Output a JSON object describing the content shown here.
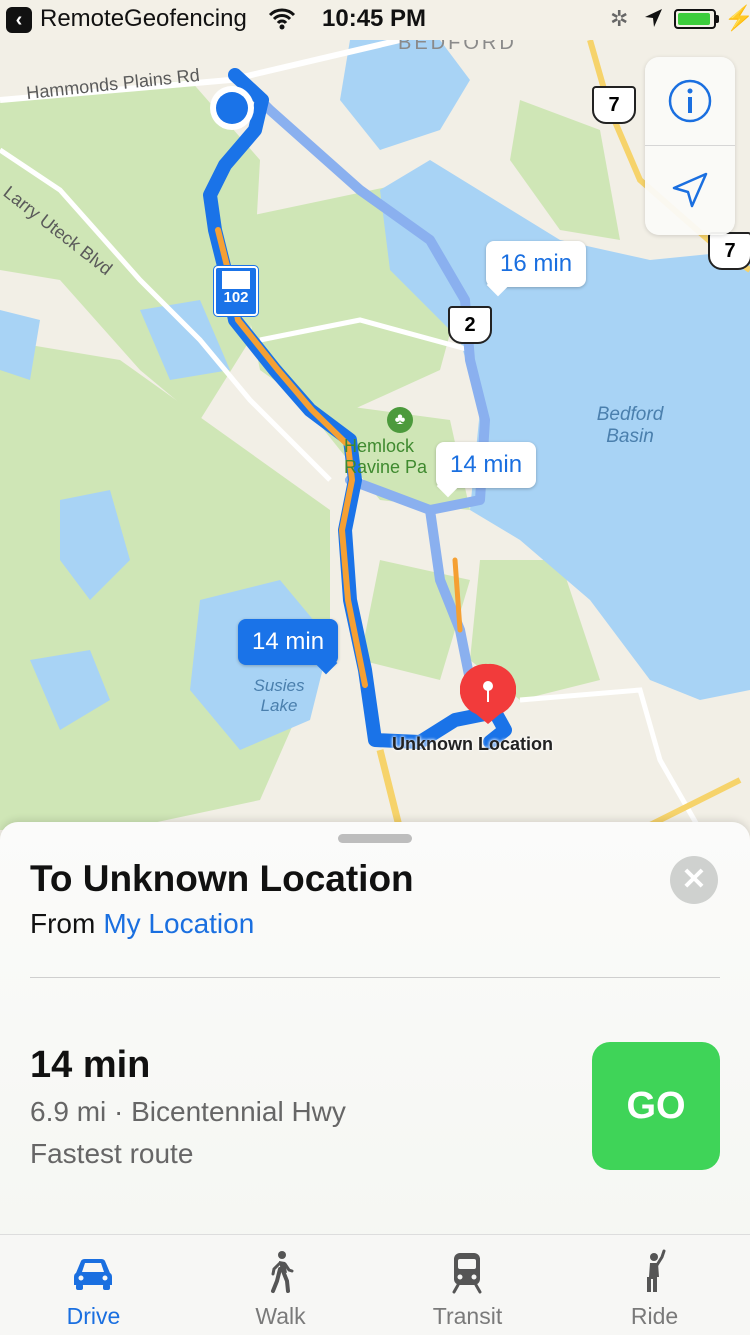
{
  "status_bar": {
    "back_app": "RemoteGeofencing",
    "time": "10:45 PM",
    "battery_level": 0.95
  },
  "map": {
    "labels": {
      "hammonds": "Hammonds Plains Rd",
      "larry": "Larry Uteck Blvd",
      "bedford_top": "BEDFORD",
      "bedford_basin": "Bedford Basin",
      "hemlock": "Hemlock Ravine Pa",
      "susies": "Susies Lake"
    },
    "shields": {
      "hwy7_top": "7",
      "hwy7_right": "7",
      "hwy2": "2",
      "hwy102": "102"
    },
    "route_callouts": [
      {
        "text": "16 min"
      },
      {
        "text": "14 min"
      },
      {
        "text": "14 min"
      }
    ],
    "destination_label": "Unknown Location",
    "colors": {
      "water": "#a8d3f5",
      "park": "#cfe6b6",
      "route": "#1a73e8",
      "alt_route": "#8ab0ef",
      "traffic": "#f5a033"
    }
  },
  "map_controls": {
    "info": "info-icon",
    "locate": "location-arrow-icon"
  },
  "sheet": {
    "title": "To Unknown Location",
    "from_prefix": "From",
    "from_link": "My Location",
    "route_time": "14 min",
    "route_detail": "6.9 mi · Bicentennial Hwy",
    "route_note": "Fastest route",
    "go_label": "GO"
  },
  "tabs": [
    {
      "label": "Drive",
      "icon": "car-icon"
    },
    {
      "label": "Walk",
      "icon": "walk-icon"
    },
    {
      "label": "Transit",
      "icon": "train-icon"
    },
    {
      "label": "Ride",
      "icon": "ride-icon"
    }
  ]
}
